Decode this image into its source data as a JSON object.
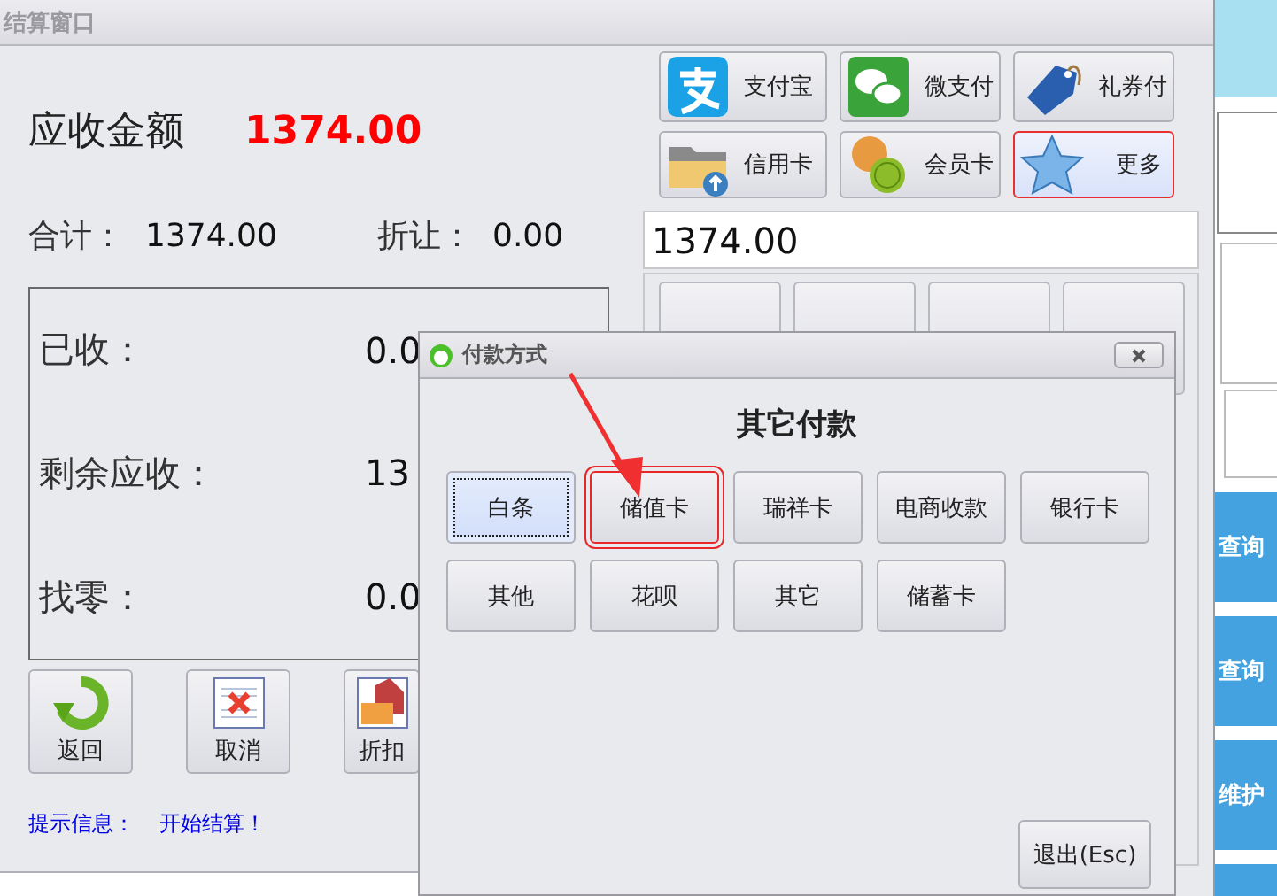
{
  "main_window": {
    "title": "结算窗口",
    "amount_due": {
      "label": "应收金额",
      "value": "1374.00"
    },
    "summary": [
      {
        "label": "合计：",
        "value": "1374.00"
      },
      {
        "label": "折让：",
        "value": "0.00"
      }
    ],
    "balances": [
      {
        "label": "已收：",
        "value": "0.0"
      },
      {
        "label": "剩余应收：",
        "value": "13"
      },
      {
        "label": "找零：",
        "value": "0.0"
      }
    ],
    "actions": [
      "返回",
      "取消",
      "折扣"
    ],
    "status": {
      "label": "提示信息：",
      "message": "开始结算！"
    },
    "payment_methods": [
      {
        "label": "支付宝",
        "selected": false
      },
      {
        "label": "微支付",
        "selected": false
      },
      {
        "label": "礼券付",
        "selected": false
      },
      {
        "label": "信用卡",
        "selected": false
      },
      {
        "label": "会员卡",
        "selected": false
      },
      {
        "label": "更多",
        "selected": true
      }
    ],
    "amount_field": {
      "value": "1374.00"
    }
  },
  "dialog": {
    "title": "付款方式",
    "heading": "其它付款",
    "options": [
      {
        "label": "白条",
        "focused": true,
        "annotated": false
      },
      {
        "label": "储值卡",
        "focused": false,
        "annotated": true
      },
      {
        "label": "瑞祥卡",
        "focused": false,
        "annotated": false
      },
      {
        "label": "电商收款",
        "focused": false,
        "annotated": false
      },
      {
        "label": "银行卡",
        "focused": false,
        "annotated": false
      },
      {
        "label": "其他",
        "focused": false,
        "annotated": false
      },
      {
        "label": "花呗",
        "focused": false,
        "annotated": false
      },
      {
        "label": "其它",
        "focused": false,
        "annotated": false
      },
      {
        "label": "储蓄卡",
        "focused": false,
        "annotated": false
      }
    ],
    "exit_button": "退出(Esc)"
  },
  "side_buttons": [
    "查询",
    "查询",
    "维护"
  ]
}
